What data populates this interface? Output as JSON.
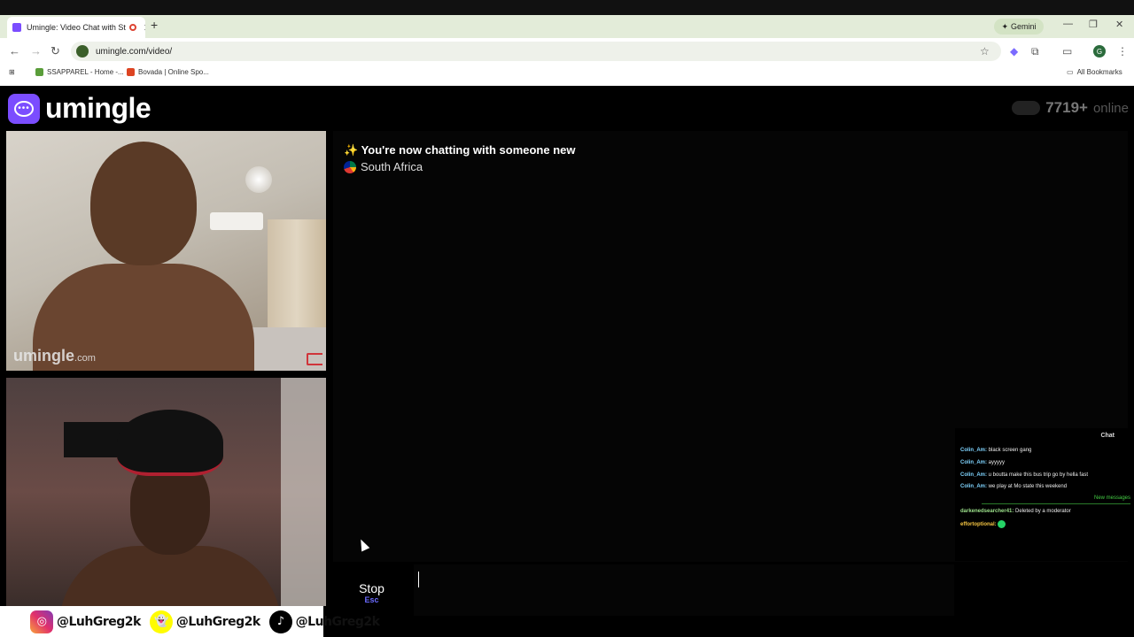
{
  "browser": {
    "tab_title": "Umingle: Video Chat with St",
    "new_tab": "+",
    "gemini_label": "Gemini",
    "url": "umingle.com/video/",
    "bookmarks": [
      {
        "label": "SSAPPAREL - Home -..."
      },
      {
        "label": "Bovada | Online Spo..."
      }
    ],
    "all_bookmarks": "All Bookmarks",
    "profile_initial": "G"
  },
  "site": {
    "logo_text": "umingle",
    "online_count": "7719+",
    "online_label": "online"
  },
  "video": {
    "watermark_main": "umingle",
    "watermark_tld": ".com"
  },
  "socials": [
    {
      "icon": "instagram-icon",
      "handle": "@LuhGreg2k"
    },
    {
      "icon": "snapchat-icon",
      "handle": "@LuhGreg2k"
    },
    {
      "icon": "tiktok-icon",
      "handle": "@LuhGreg2k"
    }
  ],
  "chat": {
    "system_emoji": "✨",
    "system_message": "You're now chatting with someone new",
    "country": "South Africa"
  },
  "stream_chat": {
    "header": "Chat",
    "messages": [
      {
        "user": "Colin_Am:",
        "text": "black screen gang"
      },
      {
        "user": "Colin_Am:",
        "text": "ayyyyy"
      },
      {
        "user": "Colin_Am:",
        "text": "u boutta make this bus trip go by hella fast"
      },
      {
        "user": "Colin_Am:",
        "text": "we play at Mo state this weekend"
      }
    ],
    "new_messages_label": "New messages",
    "after": [
      {
        "user": "darkenedsearcher41:",
        "text": "Deleted by a moderator"
      },
      {
        "user": "effortoptional:",
        "text": ""
      }
    ]
  },
  "controls": {
    "stop_label": "Stop",
    "stop_key": "Esc"
  },
  "colors": {
    "brand": "#7b4dff",
    "stop_key": "#6b6bff"
  }
}
